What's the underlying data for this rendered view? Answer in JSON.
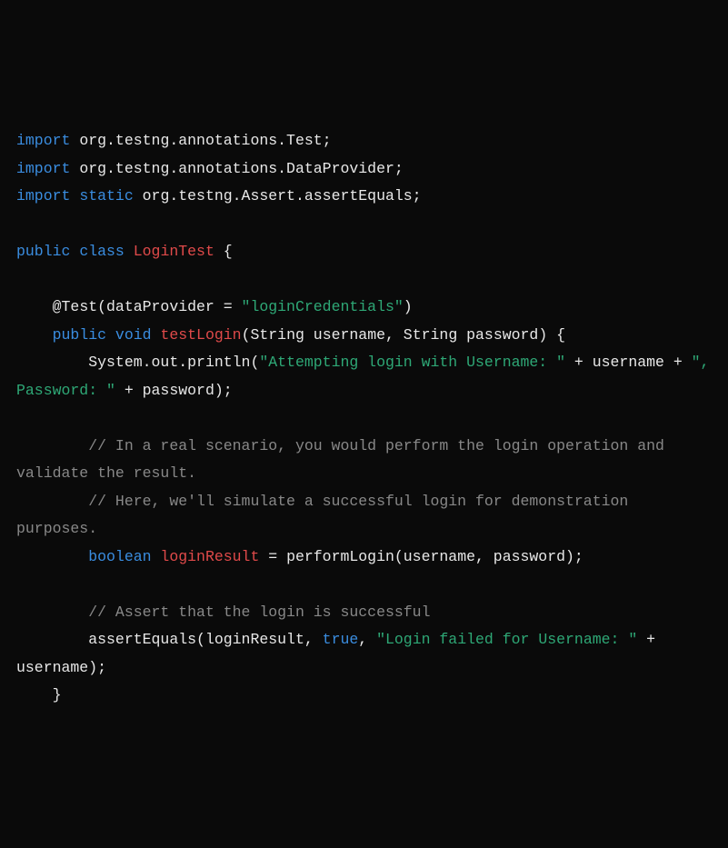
{
  "code": {
    "line1": {
      "import": "import",
      "pkg": " org.testng.annotations.Test;"
    },
    "line2": {
      "import": "import",
      "pkg": " org.testng.annotations.DataProvider;"
    },
    "line3": {
      "import": "import",
      "static": " static",
      "pkg": " org.testng.Assert.assertEquals;"
    },
    "line5": {
      "public": "public",
      "class": " class ",
      "name": "LoginTest",
      "brace": " {"
    },
    "line7": {
      "indent": "    ",
      "annotation": "@Test(dataProvider = ",
      "str": "\"loginCredentials\"",
      "close": ")"
    },
    "line8": {
      "indent": "    ",
      "public": "public",
      "void": " void ",
      "method": "testLogin",
      "params": "(String username, String password) {"
    },
    "line9": {
      "indent": "        ",
      "stmt": "System.out.println(",
      "str": "\"Attempting login with Username: \"",
      "plus": " + username + ",
      "str2": "\", Password: \"",
      "plus2": " + password);"
    },
    "line11": {
      "indent": "        ",
      "comment": "// In a real scenario, you would perform the login operation and validate the result."
    },
    "line12": {
      "indent": "        ",
      "comment": "// Here, we'll simulate a successful login for demonstration purposes."
    },
    "line13": {
      "indent": "        ",
      "boolean": "boolean",
      "var": " loginResult",
      "rest": " = performLogin(username, password);"
    },
    "line15": {
      "indent": "        ",
      "comment": "// Assert that the login is successful"
    },
    "line16": {
      "indent": "        ",
      "stmt": "assertEquals(loginResult, ",
      "bool": "true",
      "comma": ", ",
      "str": "\"Login failed for Username: \"",
      "plus": " + username);"
    },
    "line17": {
      "indent": "    ",
      "brace": "}"
    }
  }
}
